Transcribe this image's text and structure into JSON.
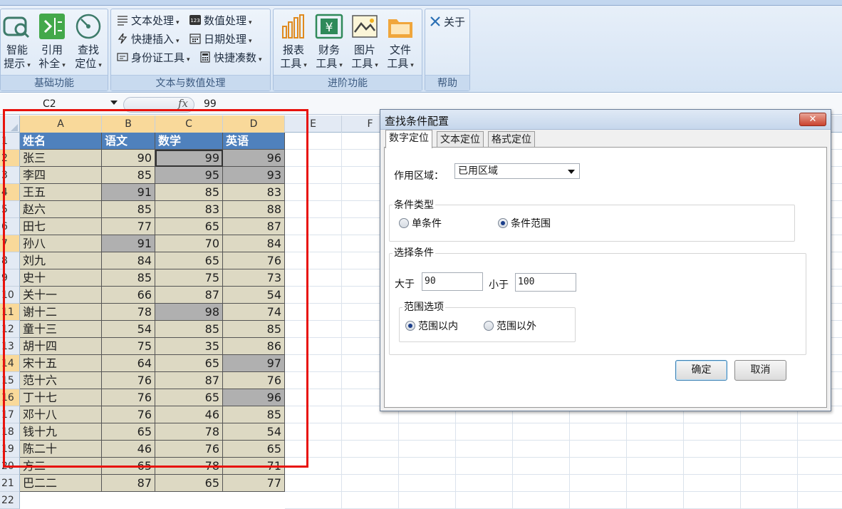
{
  "ribbon": {
    "groups": {
      "basic": "基础功能",
      "text_num": "文本与数值处理",
      "advanced": "进阶功能",
      "help": "帮助"
    },
    "basic_buttons": [
      {
        "line1": "智能",
        "line2": "提示"
      },
      {
        "line1": "引用",
        "line2": "补全"
      },
      {
        "line1": "查找",
        "line2": "定位"
      }
    ],
    "text_buttons": [
      "文本处理",
      "快捷插入",
      "身份证工具",
      "数值处理",
      "日期处理",
      "快捷凑数"
    ],
    "advanced_buttons": [
      {
        "line1": "报表",
        "line2": "工具"
      },
      {
        "line1": "财务",
        "line2": "工具"
      },
      {
        "line1": "图片",
        "line2": "工具"
      },
      {
        "line1": "文件",
        "line2": "工具"
      }
    ],
    "about": "关于"
  },
  "formula_bar": {
    "name_box": "C2",
    "fx": "fx",
    "value": "99"
  },
  "sheet": {
    "columns": [
      "A",
      "B",
      "C",
      "D",
      "E",
      "F"
    ],
    "header_row": [
      "姓名",
      "语文",
      "数学",
      "英语"
    ],
    "rows": [
      [
        "张三",
        "90",
        "99",
        "96"
      ],
      [
        "李四",
        "85",
        "95",
        "93"
      ],
      [
        "王五",
        "91",
        "85",
        "83"
      ],
      [
        "赵六",
        "85",
        "83",
        "88"
      ],
      [
        "田七",
        "77",
        "65",
        "87"
      ],
      [
        "孙八",
        "91",
        "70",
        "84"
      ],
      [
        "刘九",
        "84",
        "65",
        "76"
      ],
      [
        "史十",
        "85",
        "75",
        "73"
      ],
      [
        "关十一",
        "66",
        "87",
        "54"
      ],
      [
        "谢十二",
        "78",
        "98",
        "74"
      ],
      [
        "童十三",
        "54",
        "85",
        "85"
      ],
      [
        "胡十四",
        "75",
        "35",
        "86"
      ],
      [
        "宋十五",
        "64",
        "65",
        "97"
      ],
      [
        "范十六",
        "76",
        "87",
        "76"
      ],
      [
        "丁十七",
        "76",
        "65",
        "96"
      ],
      [
        "邓十八",
        "76",
        "46",
        "85"
      ],
      [
        "钱十九",
        "65",
        "78",
        "54"
      ],
      [
        "陈二十",
        "46",
        "76",
        "65"
      ],
      [
        "方二",
        "65",
        "78",
        "71"
      ],
      [
        "巴二二",
        "87",
        "65",
        "77"
      ]
    ],
    "row_numbers": [
      "1",
      "2",
      "3",
      "4",
      "5",
      "6",
      "7",
      "8",
      "9",
      "10",
      "11",
      "12",
      "13",
      "14",
      "15",
      "16",
      "17",
      "18",
      "19",
      "20",
      "21",
      "22"
    ]
  },
  "dialog": {
    "title": "查找条件配置",
    "close": "✕",
    "tabs": [
      "数字定位",
      "文本定位",
      "格式定位"
    ],
    "scope_label": "作用区域：",
    "scope_value": "已用区域",
    "condition_type_label": "条件类型",
    "single_condition": "单条件",
    "range_condition": "条件范围",
    "select_condition_label": "选择条件",
    "greater_label": "大于",
    "greater_value": "90",
    "less_label": "小于",
    "less_value": "100",
    "range_options_label": "范围选项",
    "inside_label": "范围以内",
    "outside_label": "范围以外",
    "ok": "确定",
    "cancel": "取消"
  },
  "colors": {
    "header_fill": "#4f81bd",
    "data_fill": "#ddd9c3",
    "highlight_fill": "#b0b0b0",
    "selection_border": "#e8120c"
  }
}
